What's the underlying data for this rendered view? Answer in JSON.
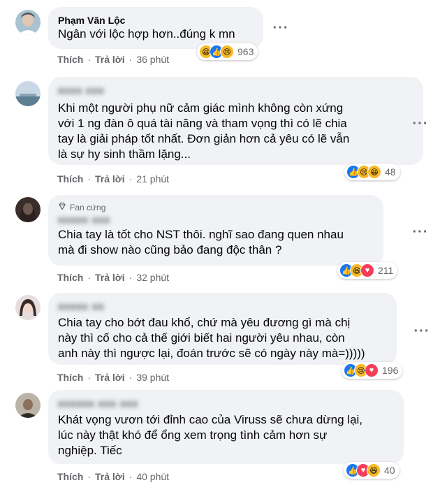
{
  "comments": [
    {
      "author": "Phạm Văn Lộc",
      "text": "Ngân với lộc hợp hơn..đúng k mn",
      "actions": {
        "like": "Thích",
        "reply": "Trả lời",
        "time": "36 phút"
      },
      "reactions": [
        "haha",
        "like",
        "sad"
      ],
      "reaction_count": "963"
    },
    {
      "author": "",
      "text": "Khi một người phụ nữ cảm giác mình không còn xứng\nvới 1 ng đàn ô quá tài năng và tham vọng thì có lẽ chia\ntay là giải pháp tốt nhất. Đơn giản hơn cả yêu có lẽ vẫn\nlà sự hy sinh thầm lặng...",
      "actions": {
        "like": "Thích",
        "reply": "Trả lời",
        "time": "21 phút"
      },
      "reactions": [
        "like",
        "sad",
        "haha"
      ],
      "reaction_count": "48"
    },
    {
      "author": "",
      "badge": "Fan cứng",
      "text": "Chia tay là tốt cho NST thôi. nghĩ sao đang quen nhau\nmà đi show nào cũng bảo đang độc thân ?",
      "actions": {
        "like": "Thích",
        "reply": "Trả lời",
        "time": "32 phút"
      },
      "reactions": [
        "like",
        "haha",
        "love"
      ],
      "reaction_count": "211"
    },
    {
      "author": "",
      "text": "Chia tay cho bớt đau khổ, chứ mà yêu đương gì mà chị\nnày thì cố cho cả thế giới biết hai người yêu nhau, còn\nanh này thì ngược lại, đoán trước sẽ có ngày này mà=)))))",
      "actions": {
        "like": "Thích",
        "reply": "Trả lời",
        "time": "39 phút"
      },
      "reactions": [
        "like",
        "sad",
        "love"
      ],
      "reaction_count": "196"
    },
    {
      "author": "",
      "text": "Khát vọng vươn tới đỉnh cao của Viruss sẽ chưa dừng lại,\nlúc này thật khó để ổng xem trọng tình cảm hơn sự\nnghiệp. Tiếc",
      "actions": {
        "like": "Thích",
        "reply": "Trả lời",
        "time": "40 phút"
      },
      "reactions": [
        "like",
        "love",
        "haha"
      ],
      "reaction_count": "40"
    }
  ],
  "colors": {
    "bubble": "#f0f2f5",
    "like": "#1877f2",
    "love": "#f33e58",
    "haha": "#f7b928",
    "meta": "#65676b"
  },
  "icons": {
    "more": "more-horizontal-icon",
    "badge": "diamond-icon"
  }
}
